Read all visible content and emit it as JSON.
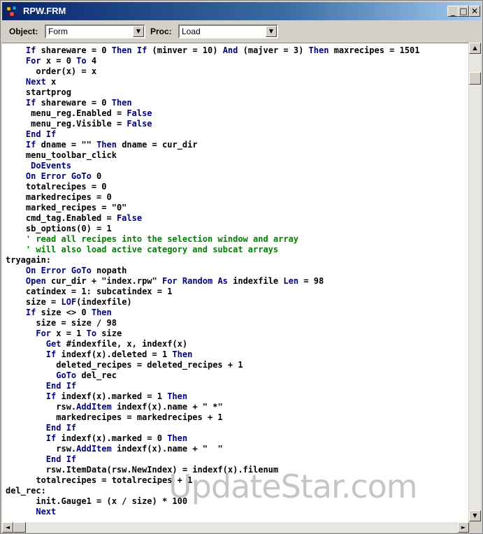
{
  "window": {
    "title": "RPW.FRM",
    "minimize_glyph": "_",
    "maximize_glyph": "□",
    "close_glyph": "✕"
  },
  "toolbar": {
    "object_label": "Object:",
    "object_value": "Form",
    "proc_label": "Proc:",
    "proc_value": "Load"
  },
  "code_lines": [
    [
      {
        "t": "    ",
        "s": "t"
      },
      {
        "t": "If",
        "s": "k"
      },
      {
        "t": " shareware = 0 ",
        "s": "t"
      },
      {
        "t": "Then",
        "s": "k"
      },
      {
        "t": " ",
        "s": "t"
      },
      {
        "t": "If",
        "s": "k"
      },
      {
        "t": " (minver = 10) ",
        "s": "t"
      },
      {
        "t": "And",
        "s": "k"
      },
      {
        "t": " (majver = 3) ",
        "s": "t"
      },
      {
        "t": "Then",
        "s": "k"
      },
      {
        "t": " maxrecipes = 1501",
        "s": "t"
      }
    ],
    [
      {
        "t": "    ",
        "s": "t"
      },
      {
        "t": "For",
        "s": "k"
      },
      {
        "t": " x = 0 ",
        "s": "t"
      },
      {
        "t": "To",
        "s": "k"
      },
      {
        "t": " 4",
        "s": "t"
      }
    ],
    [
      {
        "t": "      order(x) = x",
        "s": "t"
      }
    ],
    [
      {
        "t": "    ",
        "s": "t"
      },
      {
        "t": "Next",
        "s": "k"
      },
      {
        "t": " x",
        "s": "t"
      }
    ],
    [
      {
        "t": "    startprog",
        "s": "t"
      }
    ],
    [
      {
        "t": "    ",
        "s": "t"
      },
      {
        "t": "If",
        "s": "k"
      },
      {
        "t": " shareware = 0 ",
        "s": "t"
      },
      {
        "t": "Then",
        "s": "k"
      }
    ],
    [
      {
        "t": "     menu_reg.Enabled = ",
        "s": "t"
      },
      {
        "t": "False",
        "s": "k"
      }
    ],
    [
      {
        "t": "     menu_reg.Visible = ",
        "s": "t"
      },
      {
        "t": "False",
        "s": "k"
      }
    ],
    [
      {
        "t": "    ",
        "s": "t"
      },
      {
        "t": "End If",
        "s": "k"
      }
    ],
    [
      {
        "t": "    ",
        "s": "t"
      },
      {
        "t": "If",
        "s": "k"
      },
      {
        "t": " dname = \"\" ",
        "s": "t"
      },
      {
        "t": "Then",
        "s": "k"
      },
      {
        "t": " dname = cur_dir",
        "s": "t"
      }
    ],
    [
      {
        "t": "    menu_toolbar_click",
        "s": "t"
      }
    ],
    [
      {
        "t": "     ",
        "s": "t"
      },
      {
        "t": "DoEvents",
        "s": "k"
      }
    ],
    [
      {
        "t": "    ",
        "s": "t"
      },
      {
        "t": "On Error GoTo",
        "s": "k"
      },
      {
        "t": " 0",
        "s": "t"
      }
    ],
    [
      {
        "t": "    totalrecipes = 0",
        "s": "t"
      }
    ],
    [
      {
        "t": "    markedrecipes = 0",
        "s": "t"
      }
    ],
    [
      {
        "t": "    marked_recipes = \"0\"",
        "s": "t"
      }
    ],
    [
      {
        "t": "    cmd_tag.Enabled = ",
        "s": "t"
      },
      {
        "t": "False",
        "s": "k"
      }
    ],
    [
      {
        "t": "    sb_options(0) = 1",
        "s": "t"
      }
    ],
    [
      {
        "t": "    ' read all recipes into the selection window and array",
        "s": "c"
      }
    ],
    [
      {
        "t": "    ' will also load active category and subcat arrays",
        "s": "c"
      }
    ],
    [
      {
        "t": "tryagain:",
        "s": "t"
      }
    ],
    [
      {
        "t": "    ",
        "s": "t"
      },
      {
        "t": "On Error GoTo",
        "s": "k"
      },
      {
        "t": " nopath",
        "s": "t"
      }
    ],
    [
      {
        "t": "    ",
        "s": "t"
      },
      {
        "t": "Open",
        "s": "k"
      },
      {
        "t": " cur_dir + \"index.rpw\" ",
        "s": "t"
      },
      {
        "t": "For Random As",
        "s": "k"
      },
      {
        "t": " indexfile ",
        "s": "t"
      },
      {
        "t": "Len",
        "s": "k"
      },
      {
        "t": " = 98",
        "s": "t"
      }
    ],
    [
      {
        "t": "    catindex = 1: subcatindex = 1",
        "s": "t"
      }
    ],
    [
      {
        "t": "    size = ",
        "s": "t"
      },
      {
        "t": "LOF",
        "s": "k"
      },
      {
        "t": "(indexfile)",
        "s": "t"
      }
    ],
    [
      {
        "t": "    ",
        "s": "t"
      },
      {
        "t": "If",
        "s": "k"
      },
      {
        "t": " size <> 0 ",
        "s": "t"
      },
      {
        "t": "Then",
        "s": "k"
      }
    ],
    [
      {
        "t": "      size = size / 98",
        "s": "t"
      }
    ],
    [
      {
        "t": "      ",
        "s": "t"
      },
      {
        "t": "For",
        "s": "k"
      },
      {
        "t": " x = 1 ",
        "s": "t"
      },
      {
        "t": "To",
        "s": "k"
      },
      {
        "t": " size",
        "s": "t"
      }
    ],
    [
      {
        "t": "        ",
        "s": "t"
      },
      {
        "t": "Get",
        "s": "k"
      },
      {
        "t": " #indexfile, x, indexf(x)",
        "s": "t"
      }
    ],
    [
      {
        "t": "        ",
        "s": "t"
      },
      {
        "t": "If",
        "s": "k"
      },
      {
        "t": " indexf(x).deleted = 1 ",
        "s": "t"
      },
      {
        "t": "Then",
        "s": "k"
      }
    ],
    [
      {
        "t": "          deleted_recipes = deleted_recipes + 1",
        "s": "t"
      }
    ],
    [
      {
        "t": "          ",
        "s": "t"
      },
      {
        "t": "GoTo",
        "s": "k"
      },
      {
        "t": " del_rec",
        "s": "t"
      }
    ],
    [
      {
        "t": "        ",
        "s": "t"
      },
      {
        "t": "End If",
        "s": "k"
      }
    ],
    [
      {
        "t": "        ",
        "s": "t"
      },
      {
        "t": "If",
        "s": "k"
      },
      {
        "t": " indexf(x).marked = 1 ",
        "s": "t"
      },
      {
        "t": "Then",
        "s": "k"
      }
    ],
    [
      {
        "t": "          rsw.",
        "s": "t"
      },
      {
        "t": "AddItem",
        "s": "k"
      },
      {
        "t": " indexf(x).name + \" *\"",
        "s": "t"
      }
    ],
    [
      {
        "t": "          markedrecipes = markedrecipes + 1",
        "s": "t"
      }
    ],
    [
      {
        "t": "        ",
        "s": "t"
      },
      {
        "t": "End If",
        "s": "k"
      }
    ],
    [
      {
        "t": "        ",
        "s": "t"
      },
      {
        "t": "If",
        "s": "k"
      },
      {
        "t": " indexf(x).marked = 0 ",
        "s": "t"
      },
      {
        "t": "Then",
        "s": "k"
      }
    ],
    [
      {
        "t": "          rsw.",
        "s": "t"
      },
      {
        "t": "AddItem",
        "s": "k"
      },
      {
        "t": " indexf(x).name + \"  \"",
        "s": "t"
      }
    ],
    [
      {
        "t": "        ",
        "s": "t"
      },
      {
        "t": "End If",
        "s": "k"
      }
    ],
    [
      {
        "t": "        rsw.ItemData(rsw.NewIndex) = indexf(x).filenum",
        "s": "t"
      }
    ],
    [
      {
        "t": "      totalrecipes = totalrecipes + 1",
        "s": "t"
      }
    ],
    [
      {
        "t": "del_rec:",
        "s": "t"
      }
    ],
    [
      {
        "t": "      init.Gauge1 = (x / size) * 100",
        "s": "t"
      }
    ],
    [
      {
        "t": "      ",
        "s": "t"
      },
      {
        "t": "Next",
        "s": "k"
      }
    ]
  ],
  "watermark": "UpdateStar.com",
  "icons": [
    "app-icon",
    "minimize-icon",
    "maximize-icon",
    "close-icon",
    "dropdown-arrow-icon",
    "scroll-arrow-icon"
  ],
  "colors": {
    "keyword": "#00007f",
    "comment": "#007f00",
    "text": "#000000",
    "titlebar": "#0a246a"
  }
}
